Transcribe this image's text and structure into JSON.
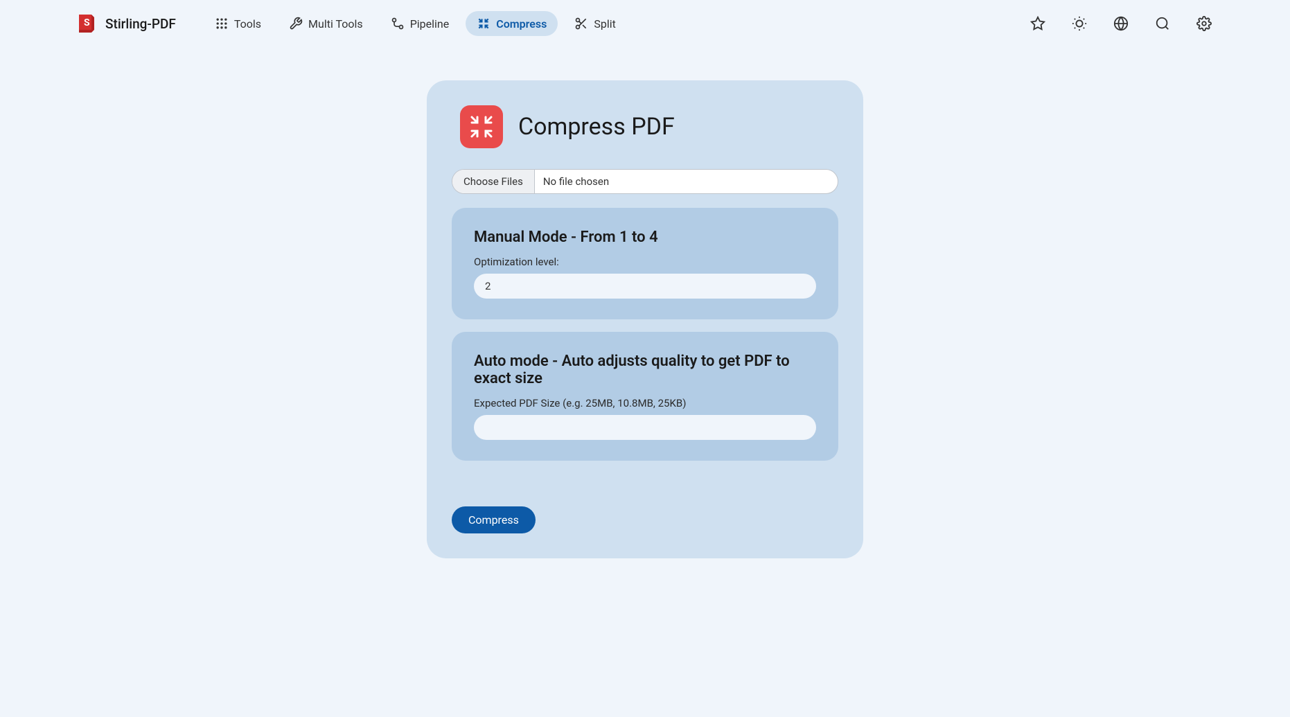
{
  "brand": {
    "name": "Stirling-PDF"
  },
  "nav": {
    "tools": "Tools",
    "multiTools": "Multi Tools",
    "pipeline": "Pipeline",
    "compress": "Compress",
    "split": "Split"
  },
  "page": {
    "title": "Compress PDF"
  },
  "fileInput": {
    "button": "Choose Files",
    "status": "No file chosen"
  },
  "manualMode": {
    "title": "Manual Mode - From 1 to 4",
    "label": "Optimization level:",
    "value": "2"
  },
  "autoMode": {
    "title": "Auto mode - Auto adjusts quality to get PDF to exact size",
    "label": "Expected PDF Size (e.g. 25MB, 10.8MB, 25KB)",
    "value": ""
  },
  "submit": {
    "label": "Compress"
  }
}
